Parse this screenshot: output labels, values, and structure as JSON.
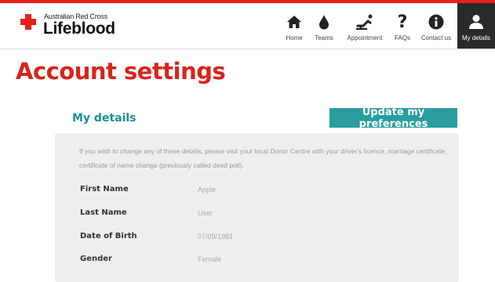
{
  "brand": {
    "top_line": "Australian Red Cross",
    "name": "Lifeblood",
    "colors": {
      "red": "#e5211b",
      "teal": "#2a9da0",
      "dark": "#2a2a2a"
    }
  },
  "nav": {
    "items": [
      {
        "label": "Home",
        "icon": "home-icon"
      },
      {
        "label": "Teams",
        "icon": "blood-drop-icon"
      },
      {
        "label": "Appointment",
        "icon": "donation-chair-icon"
      },
      {
        "label": "FAQs",
        "icon": "question-mark-icon"
      },
      {
        "label": "Contact us",
        "icon": "info-icon"
      },
      {
        "label": "My details",
        "icon": "user-icon",
        "active": true
      }
    ]
  },
  "page": {
    "title": "Account settings"
  },
  "details": {
    "title": "My details",
    "update_button": "Update my preferences",
    "info_text": "If you wish to change any of these details, please visit your local Donor Centre with your driver's licence, marriage certificate, certificate of name change (previously called deed poll).",
    "fields": [
      {
        "label": "First Name",
        "value": "Apple"
      },
      {
        "label": "Last Name",
        "value": "User"
      },
      {
        "label": "Date of Birth",
        "value": "07/09/1981"
      },
      {
        "label": "Gender",
        "value": "Female"
      }
    ]
  }
}
